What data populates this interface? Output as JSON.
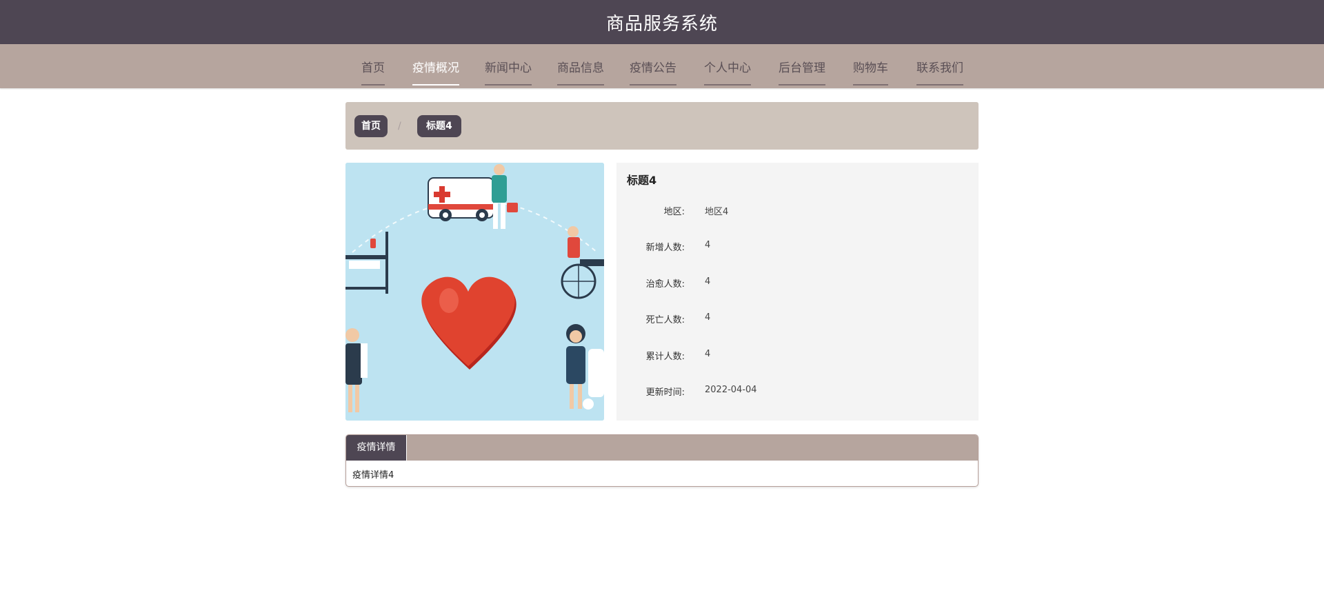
{
  "header": {
    "title": "商品服务系统"
  },
  "nav": {
    "items": [
      {
        "label": "首页"
      },
      {
        "label": "疫情概况"
      },
      {
        "label": "新闻中心"
      },
      {
        "label": "商品信息"
      },
      {
        "label": "疫情公告"
      },
      {
        "label": "个人中心"
      },
      {
        "label": "后台管理"
      },
      {
        "label": "购物车"
      },
      {
        "label": "联系我们"
      }
    ],
    "active": "疫情概况"
  },
  "breadcrumb": {
    "home": "首页",
    "separator": "/",
    "current": "标题4"
  },
  "image": {
    "icon": "heart-medical-illustration"
  },
  "info": {
    "title": "标题4",
    "rows": [
      {
        "key": "地区:",
        "value": "地区4"
      },
      {
        "key": "新增人数:",
        "value": "4"
      },
      {
        "key": "治愈人数:",
        "value": "4"
      },
      {
        "key": "死亡人数:",
        "value": "4"
      },
      {
        "key": "累计人数:",
        "value": "4"
      },
      {
        "key": "更新时间:",
        "value": "2022-04-04"
      }
    ]
  },
  "detail": {
    "tab_label": "疫情详情",
    "content": "疫情详情4"
  },
  "colors": {
    "header_bg": "#4e4653",
    "nav_bg": "#b6a59e",
    "breadcrumb_bg": "#cec4bb",
    "panel_bg": "#f4f4f4"
  }
}
